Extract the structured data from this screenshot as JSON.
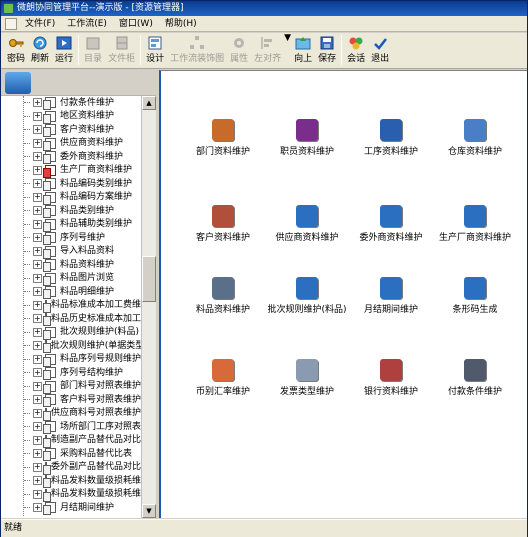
{
  "window": {
    "title": "微朗协同管理平台--演示版 - [资源管理器]"
  },
  "menu": [
    {
      "id": "file",
      "label": "文件(F)"
    },
    {
      "id": "workflow",
      "label": "工作流(E)"
    },
    {
      "id": "window",
      "label": "窗口(W)"
    },
    {
      "id": "help",
      "label": "帮助(H)"
    }
  ],
  "toolbar": [
    {
      "id": "password",
      "label": "密码",
      "icon": "key-icon",
      "enabled": true
    },
    {
      "id": "refresh",
      "label": "刷新",
      "icon": "refresh-icon",
      "enabled": true
    },
    {
      "id": "run",
      "label": "运行",
      "icon": "run-icon",
      "enabled": true
    },
    {
      "id": "catalog",
      "label": "目录",
      "icon": "folder-icon",
      "enabled": false
    },
    {
      "id": "file",
      "label": "文件柜",
      "icon": "cabinet-icon",
      "enabled": false
    },
    {
      "id": "design",
      "label": "设计",
      "icon": "design-icon",
      "enabled": true
    },
    {
      "id": "wf-diagram",
      "label": "工作流装饰图",
      "icon": "flow-icon",
      "enabled": false
    },
    {
      "id": "props",
      "label": "属性",
      "icon": "gear-icon",
      "enabled": false
    },
    {
      "id": "align-left",
      "label": "左对齐",
      "icon": "align-left-icon",
      "enabled": false
    },
    {
      "id": "up",
      "label": "向上",
      "icon": "up-icon",
      "enabled": true
    },
    {
      "id": "save",
      "label": "保存",
      "icon": "save-icon",
      "enabled": true
    },
    {
      "id": "session",
      "label": "会话",
      "icon": "session-icon",
      "enabled": true
    },
    {
      "id": "exit",
      "label": "退出",
      "icon": "exit-icon",
      "enabled": true
    }
  ],
  "tree": [
    {
      "label": "付款条件维护",
      "icon": "document-icon"
    },
    {
      "label": "地区资料维护",
      "icon": "document-icon"
    },
    {
      "label": "客户资料维护",
      "icon": "document-icon"
    },
    {
      "label": "供应商资料维护",
      "icon": "document-icon"
    },
    {
      "label": "委外商资料维护",
      "icon": "document-icon"
    },
    {
      "label": "生产厂商资料维护",
      "icon": "document-stop-icon"
    },
    {
      "label": "料品编码类别维护",
      "icon": "document-icon"
    },
    {
      "label": "料品编码方案维护",
      "icon": "document-icon"
    },
    {
      "label": "料品类别维护",
      "icon": "document-icon"
    },
    {
      "label": "料品辅助类别维护",
      "icon": "document-icon"
    },
    {
      "label": "序列号维护",
      "icon": "document-icon"
    },
    {
      "label": "导入料品资料",
      "icon": "document-icon"
    },
    {
      "label": "料品资料维护",
      "icon": "document-icon"
    },
    {
      "label": "料品图片浏览",
      "icon": "document-icon"
    },
    {
      "label": "料品明细维护",
      "icon": "document-icon"
    },
    {
      "label": "料品标准成本加工费维",
      "icon": "document-icon"
    },
    {
      "label": "料品历史标准成本加工",
      "icon": "document-icon"
    },
    {
      "label": "批次规则维护(料品)",
      "icon": "document-icon"
    },
    {
      "label": "批次规则维护(单据类型",
      "icon": "document-icon"
    },
    {
      "label": "料品序列号规则维护",
      "icon": "document-icon"
    },
    {
      "label": "序列号结构维护",
      "icon": "document-icon"
    },
    {
      "label": "部门料号对照表维护",
      "icon": "document-icon"
    },
    {
      "label": "客户料号对照表维护",
      "icon": "document-icon"
    },
    {
      "label": "供应商料号对照表维护",
      "icon": "document-icon"
    },
    {
      "label": "场所部门工序对照表",
      "icon": "document-icon"
    },
    {
      "label": "制造副产品替代品对比",
      "icon": "document-icon"
    },
    {
      "label": "采购料品替代比表",
      "icon": "document-icon"
    },
    {
      "label": "委外副产品替代品对比",
      "icon": "document-icon"
    },
    {
      "label": "料品发料数量级损耗维",
      "icon": "document-icon"
    },
    {
      "label": "料品发料数量级损耗维",
      "icon": "document-icon"
    },
    {
      "label": "月结期间维护",
      "icon": "document-icon"
    }
  ],
  "tiles": [
    {
      "label": "部门资料维护",
      "icon": "department-icon",
      "color": "#c86a2a"
    },
    {
      "label": "职员资料维护",
      "icon": "employee-icon",
      "color": "#7a2e8c"
    },
    {
      "label": "工序资料维护",
      "icon": "process-icon",
      "color": "#2a5fb0"
    },
    {
      "label": "仓库资料维护",
      "icon": "warehouse-icon",
      "color": "#4a7fc8"
    },
    {
      "label": "客户资料维护",
      "icon": "customer-icon",
      "color": "#b0503a"
    },
    {
      "label": "供应商资料维护",
      "icon": "supplier-icon",
      "color": "#2a6fc0"
    },
    {
      "label": "委外商资料维护",
      "icon": "outsource-icon",
      "color": "#2a6fc0"
    },
    {
      "label": "生产厂商资料维护",
      "icon": "manufacturer-icon",
      "color": "#2a6fc0"
    },
    {
      "label": "料品资料维护",
      "icon": "material-icon",
      "color": "#5a6f8a"
    },
    {
      "label": "批次规则维护(料品)",
      "icon": "batch-icon",
      "color": "#2a6fc0"
    },
    {
      "label": "月结期间维护",
      "icon": "period-icon",
      "color": "#2a6fc0"
    },
    {
      "label": "条形码生成",
      "icon": "barcode-icon",
      "color": "#2a6fc0"
    },
    {
      "label": "币别汇率维护",
      "icon": "currency-icon",
      "color": "#d86a3a"
    },
    {
      "label": "发票类型维护",
      "icon": "invoice-icon",
      "color": "#8a9ab0"
    },
    {
      "label": "银行资料维护",
      "icon": "bank-icon",
      "color": "#b04040"
    },
    {
      "label": "付款条件维护",
      "icon": "payment-icon",
      "color": "#505a6a"
    }
  ],
  "status": {
    "text": "就绪"
  }
}
